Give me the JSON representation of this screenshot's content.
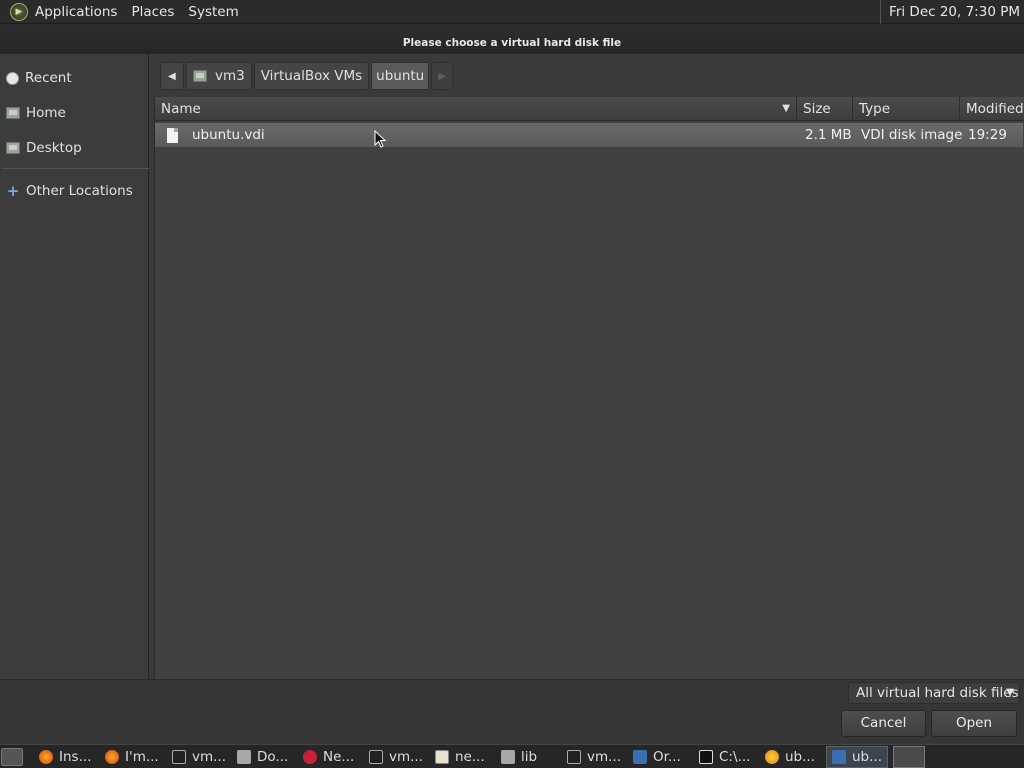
{
  "top_panel": {
    "menus": [
      "Applications",
      "Places",
      "System"
    ],
    "clock": "Fri Dec 20,  7:30 PM"
  },
  "dialog": {
    "title": "Please choose a virtual hard disk file"
  },
  "sidebar": {
    "items": [
      {
        "label": "Recent",
        "icon": "recent-icon"
      },
      {
        "label": "Home",
        "icon": "home-folder-icon"
      },
      {
        "label": "Desktop",
        "icon": "desktop-folder-icon"
      },
      {
        "label": "Other Locations",
        "icon": "plus-icon"
      }
    ]
  },
  "pathbar": {
    "segments": [
      "vm3",
      "VirtualBox VMs",
      "ubuntu"
    ],
    "active_segment": "ubuntu"
  },
  "file_list": {
    "columns": [
      "Name",
      "Size",
      "Type",
      "Modified"
    ],
    "rows": [
      {
        "name": "ubuntu.vdi",
        "size": "2.1 MB",
        "type": "VDI disk image",
        "modified": "19:29",
        "selected": true
      }
    ]
  },
  "filter": {
    "selected": "All virtual hard disk files"
  },
  "buttons": {
    "cancel": "Cancel",
    "open": "Open"
  },
  "taskbar": {
    "tasks": [
      {
        "label": "Ins...",
        "icon": "firefox-icon"
      },
      {
        "label": "I'm...",
        "icon": "firefox-icon"
      },
      {
        "label": "vm...",
        "icon": "terminal-icon"
      },
      {
        "label": "Do...",
        "icon": "folder-icon"
      },
      {
        "label": "Ne...",
        "icon": "media-icon"
      },
      {
        "label": "vm...",
        "icon": "terminal-icon"
      },
      {
        "label": "ne...",
        "icon": "text-editor-icon"
      },
      {
        "label": "lib",
        "icon": "folder-icon"
      },
      {
        "label": "vm...",
        "icon": "terminal-icon"
      },
      {
        "label": "Or...",
        "icon": "virtualbox-icon"
      },
      {
        "label": "C:\\...",
        "icon": "7zip-icon"
      },
      {
        "label": "ub...",
        "icon": "settings-icon"
      },
      {
        "label": "ub...",
        "icon": "virtualbox-icon"
      }
    ]
  },
  "colors": {
    "panel": "#2b2b2b",
    "window_bg": "#414141",
    "selection": "#5f5f5f",
    "other_locations_accent": "#7aa8e0"
  }
}
